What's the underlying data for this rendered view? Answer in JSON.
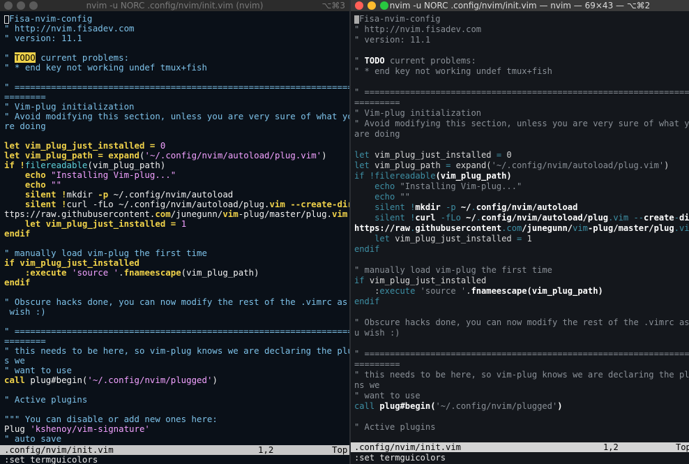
{
  "left_window": {
    "title": "nvim -u NORC .config/nvim/init.vim (nvim)",
    "shortcut": "⌥⌘3",
    "status_file": ".config/nvim/init.vim",
    "status_pos": "1,2",
    "status_top": "Top",
    "cmdline": ":set termguicolors"
  },
  "right_window": {
    "title": "nvim -u NORC .config/nvim/init.vim — nvim — 69×43 — ⌥⌘2",
    "status_file": ".config/nvim/init.vim",
    "status_pos": "1,2",
    "status_top": "Top",
    "cmdline": ":set termguicolors"
  },
  "traffic_colors": {
    "close": "#ff5f57",
    "minimize": "#febc2e",
    "zoom": "#28c840",
    "inactive": "#5a5a5a"
  },
  "left_lines": [
    [
      [
        "cursor",
        ""
      ],
      [
        "cm",
        "Fisa-nvim-config"
      ]
    ],
    [
      [
        "cm",
        "\" http://nvim.fisadev.com"
      ]
    ],
    [
      [
        "cm",
        "\" version: 11.1"
      ]
    ],
    [],
    [
      [
        "cm",
        "\" "
      ],
      [
        "hl",
        "TODO"
      ],
      [
        "cm",
        " current problems:"
      ]
    ],
    [
      [
        "cm",
        "\" * end key not working undef tmux+fish"
      ]
    ],
    [],
    [
      [
        "cm",
        "\" ====================================================================="
      ]
    ],
    [
      [
        "cm",
        "========"
      ]
    ],
    [
      [
        "cm",
        "\" Vim-plug initialization"
      ]
    ],
    [
      [
        "cm",
        "\" Avoid modifying this section, unless you are very sure of what you a"
      ]
    ],
    [
      [
        "cm",
        "re doing"
      ]
    ],
    [],
    [
      [
        "kw",
        "let"
      ],
      [
        "pl",
        " "
      ],
      [
        "ln",
        "vim_plug_just_installed"
      ],
      [
        "pl",
        " "
      ],
      [
        "kw",
        "="
      ],
      [
        "pl",
        " "
      ],
      [
        "str",
        "0"
      ]
    ],
    [
      [
        "kw",
        "let"
      ],
      [
        "pl",
        " "
      ],
      [
        "ln",
        "vim_plug_path"
      ],
      [
        "pl",
        " "
      ],
      [
        "kw",
        "="
      ],
      [
        "pl",
        " "
      ],
      [
        "ln",
        "expand"
      ],
      [
        "pl",
        "("
      ],
      [
        "str",
        "'~/.config/nvim/autoload/plug.vim'"
      ],
      [
        "pl",
        ")"
      ]
    ],
    [
      [
        "kw",
        "if"
      ],
      [
        "pl",
        " "
      ],
      [
        "kw",
        "!"
      ],
      [
        "cy",
        "filereadable"
      ],
      [
        "pl",
        "(vim_plug_path)"
      ]
    ],
    [
      [
        "pl",
        "    "
      ],
      [
        "kw",
        "echo"
      ],
      [
        "pl",
        " "
      ],
      [
        "str",
        "\"Installing Vim-plug...\""
      ]
    ],
    [
      [
        "pl",
        "    "
      ],
      [
        "kw",
        "echo"
      ],
      [
        "pl",
        " "
      ],
      [
        "str",
        "\"\""
      ]
    ],
    [
      [
        "pl",
        "    "
      ],
      [
        "kw",
        "silent !"
      ],
      [
        "pl",
        "mkdir "
      ],
      [
        "kw",
        "-p"
      ],
      [
        "pl",
        " ~/.config/nvim/autoload"
      ]
    ],
    [
      [
        "pl",
        "    "
      ],
      [
        "kw",
        "silent !"
      ],
      [
        "pl",
        "curl -fLo ~/.config/nvim/autoload/plug."
      ],
      [
        "kw",
        "vim"
      ],
      [
        "pl",
        " "
      ],
      [
        "kw",
        "--create-dirs"
      ],
      [
        "pl",
        " h"
      ]
    ],
    [
      [
        "pl",
        "ttps://raw.githubusercontent."
      ],
      [
        "kw",
        "com"
      ],
      [
        "pl",
        "/junegunn/"
      ],
      [
        "kw",
        "vim"
      ],
      [
        "pl",
        "-plug/master/plug."
      ],
      [
        "kw",
        "vim"
      ]
    ],
    [
      [
        "pl",
        "    "
      ],
      [
        "kw",
        "let"
      ],
      [
        "pl",
        " "
      ],
      [
        "ln",
        "vim_plug_just_installed"
      ],
      [
        "pl",
        " "
      ],
      [
        "kw",
        "="
      ],
      [
        "pl",
        " "
      ],
      [
        "str",
        "1"
      ]
    ],
    [
      [
        "kw",
        "endif"
      ]
    ],
    [],
    [
      [
        "cm",
        "\" manually load vim-plug the first time"
      ]
    ],
    [
      [
        "kw",
        "if"
      ],
      [
        "pl",
        " "
      ],
      [
        "ln",
        "vim_plug_just_installed"
      ]
    ],
    [
      [
        "pl",
        "    "
      ],
      [
        "kw",
        ":execute"
      ],
      [
        "pl",
        " "
      ],
      [
        "str",
        "'source '"
      ],
      [
        "pl",
        "."
      ],
      [
        "ln",
        "fnameescape"
      ],
      [
        "pl",
        "(vim_plug_path)"
      ]
    ],
    [
      [
        "kw",
        "endif"
      ]
    ],
    [],
    [
      [
        "cm",
        "\" Obscure hacks done, you can now modify the rest of the .vimrc as you"
      ]
    ],
    [
      [
        "cm",
        " wish :)"
      ]
    ],
    [],
    [
      [
        "cm",
        "\" ====================================================================="
      ]
    ],
    [
      [
        "cm",
        "========"
      ]
    ],
    [
      [
        "cm",
        "\" this needs to be here, so vim-plug knows we are declaring the plugin"
      ]
    ],
    [
      [
        "cm",
        "s we"
      ]
    ],
    [
      [
        "cm",
        "\" want to use"
      ]
    ],
    [
      [
        "kw",
        "call"
      ],
      [
        "pl",
        " "
      ],
      [
        "fn",
        "plug#begin"
      ],
      [
        "pl",
        "("
      ],
      [
        "str",
        "'~/.config/nvim/plugged'"
      ],
      [
        "pl",
        ")"
      ]
    ],
    [],
    [
      [
        "cm",
        "\" Active plugins"
      ]
    ],
    [],
    [
      [
        "cm",
        "\"\"\" You can disable or add new ones here:"
      ]
    ],
    [
      [
        "pl",
        "Plug "
      ],
      [
        "str",
        "'kshenoy/vim-signature'"
      ]
    ],
    [
      [
        "cm",
        "\" auto save"
      ]
    ]
  ],
  "right_lines": [
    [
      [
        "cursor",
        ""
      ],
      [
        "cm",
        "Fisa-nvim-config"
      ]
    ],
    [
      [
        "cm",
        "\" http://nvim.fisadev.com"
      ]
    ],
    [
      [
        "cm",
        "\" version: 11.1"
      ]
    ],
    [],
    [
      [
        "cm",
        "\" "
      ],
      [
        "hl",
        "TODO"
      ],
      [
        "cm",
        " current problems:"
      ]
    ],
    [
      [
        "cm",
        "\" * end key not working undef tmux+fish"
      ]
    ],
    [],
    [
      [
        "cm",
        "\" ====================================================================="
      ]
    ],
    [
      [
        "cm",
        "========="
      ]
    ],
    [
      [
        "cm",
        "\" Vim-plug initialization"
      ]
    ],
    [
      [
        "cm",
        "\" Avoid modifying this section, unless you are very sure of what you"
      ]
    ],
    [
      [
        "cm",
        "are doing"
      ]
    ],
    [],
    [
      [
        "kw",
        "let"
      ],
      [
        "pl",
        " vim_plug_just_installed "
      ],
      [
        "kw",
        "="
      ],
      [
        "pl",
        " 0"
      ]
    ],
    [
      [
        "kw",
        "let"
      ],
      [
        "pl",
        " vim_plug_path "
      ],
      [
        "kw",
        "="
      ],
      [
        "pl",
        " expand("
      ],
      [
        "str",
        "'~/.config/nvim/autoload/plug.vim'"
      ],
      [
        "pl",
        ")"
      ]
    ],
    [
      [
        "kw",
        "if"
      ],
      [
        "pl",
        " "
      ],
      [
        "kw",
        "!filereadable"
      ],
      [
        "bd",
        "(vim_plug_path)"
      ]
    ],
    [
      [
        "pl",
        "    "
      ],
      [
        "kw",
        "echo"
      ],
      [
        "pl",
        " "
      ],
      [
        "str",
        "\"Installing Vim-plug...\""
      ]
    ],
    [
      [
        "pl",
        "    "
      ],
      [
        "kw",
        "echo"
      ],
      [
        "pl",
        " "
      ],
      [
        "str",
        "\"\""
      ]
    ],
    [
      [
        "pl",
        "    "
      ],
      [
        "kw",
        "silent !"
      ],
      [
        "bd",
        "mkdir "
      ],
      [
        "kw",
        "-p"
      ],
      [
        "bd",
        " ~/"
      ],
      [
        "kw",
        "."
      ],
      [
        "bd",
        "config/nvim/autoload"
      ]
    ],
    [
      [
        "pl",
        "    "
      ],
      [
        "kw",
        "silent !"
      ],
      [
        "bd",
        "curl "
      ],
      [
        "kw",
        "-fLo"
      ],
      [
        "bd",
        " ~/"
      ],
      [
        "kw",
        "."
      ],
      [
        "bd",
        "config/nvim/autoload/plug"
      ],
      [
        "kw",
        ".vim --"
      ],
      [
        "bd",
        "create"
      ],
      [
        "kw",
        "-"
      ],
      [
        "bd",
        "dirs"
      ]
    ],
    [
      [
        "bd",
        "https://raw"
      ],
      [
        "kw",
        "."
      ],
      [
        "bd",
        "githubusercontent"
      ],
      [
        "kw",
        ".com"
      ],
      [
        "bd",
        "/junegunn/"
      ],
      [
        "kw",
        "vim"
      ],
      [
        "bd",
        "-plug/master/plug"
      ],
      [
        "kw",
        ".vim"
      ]
    ],
    [
      [
        "pl",
        "    "
      ],
      [
        "kw",
        "let"
      ],
      [
        "pl",
        " vim_plug_just_installed "
      ],
      [
        "kw",
        "="
      ],
      [
        "pl",
        " 1"
      ]
    ],
    [
      [
        "kw",
        "endif"
      ]
    ],
    [],
    [
      [
        "cm",
        "\" manually load vim-plug the first time"
      ]
    ],
    [
      [
        "kw",
        "if"
      ],
      [
        "pl",
        " vim_plug_just_installed"
      ]
    ],
    [
      [
        "pl",
        "    :"
      ],
      [
        "kw",
        "execute"
      ],
      [
        "pl",
        " "
      ],
      [
        "str",
        "'source '"
      ],
      [
        "pl",
        "."
      ],
      [
        "bd",
        "fnameescape(vim_plug_path)"
      ]
    ],
    [
      [
        "kw",
        "endif"
      ]
    ],
    [],
    [
      [
        "cm",
        "\" Obscure hacks done, you can now modify the rest of the .vimrc as yo"
      ]
    ],
    [
      [
        "cm",
        "u wish :)"
      ]
    ],
    [],
    [
      [
        "cm",
        "\" ====================================================================="
      ]
    ],
    [
      [
        "cm",
        "========="
      ]
    ],
    [
      [
        "cm",
        "\" this needs to be here, so vim-plug knows we are declaring the plugi"
      ]
    ],
    [
      [
        "cm",
        "ns we"
      ]
    ],
    [
      [
        "cm",
        "\" want to use"
      ]
    ],
    [
      [
        "kw",
        "call"
      ],
      [
        "pl",
        " "
      ],
      [
        "bd",
        "plug#begin("
      ],
      [
        "str",
        "'~/.config/nvim/plugged'"
      ],
      [
        "bd",
        ")"
      ]
    ],
    [],
    [
      [
        "cm",
        "\" Active plugins"
      ]
    ]
  ]
}
